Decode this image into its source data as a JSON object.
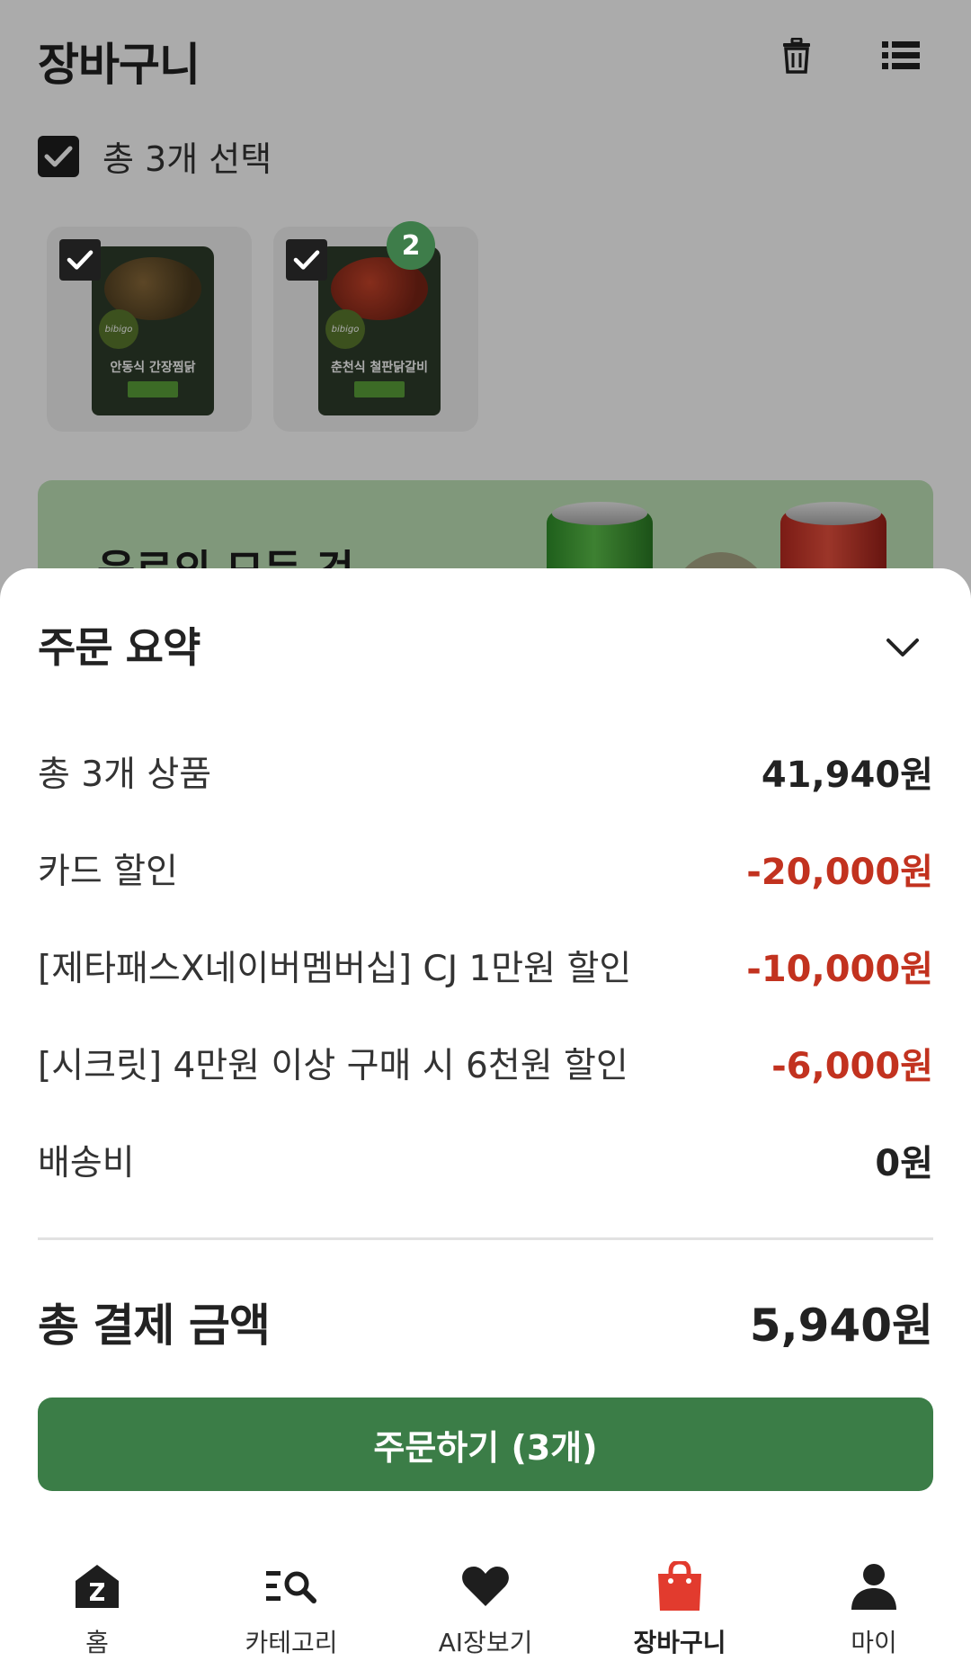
{
  "header": {
    "title": "장바구니",
    "trash_icon": "trash-icon",
    "list_icon": "list-view-icon"
  },
  "selection": {
    "label": "총 3개 선택",
    "checked": true
  },
  "cart_items": [
    {
      "name": "안동식 간장찜닭",
      "brand": "bibigo",
      "checked": true
    },
    {
      "name": "춘천식 철판닭갈비",
      "brand": "bibigo",
      "checked": true,
      "quantity_badge": "2"
    }
  ],
  "banner": {
    "text": "음료의 모든 것"
  },
  "order_summary": {
    "title": "주문 요약",
    "rows": [
      {
        "label": "총 3개 상품",
        "value": "41,940원",
        "type": "normal"
      },
      {
        "label": "카드 할인",
        "value": "-20,000원",
        "type": "discount"
      },
      {
        "label": "[제타패스X네이버멤버십] CJ 1만원 할인",
        "value": "-10,000원",
        "type": "discount"
      },
      {
        "label": "[시크릿] 4만원 이상 구매 시 6천원 할인",
        "value": "-6,000원",
        "type": "discount"
      },
      {
        "label": "배송비",
        "value": "0원",
        "type": "normal"
      }
    ],
    "total_label": "총 결제 금액",
    "total_value": "5,940원",
    "order_button_label": "주문하기 (3개)"
  },
  "nav": {
    "items": [
      {
        "label": "홈",
        "icon": "home-icon",
        "active": false
      },
      {
        "label": "카테고리",
        "icon": "category-search-icon",
        "active": false
      },
      {
        "label": "AI장보기",
        "icon": "heart-icon",
        "active": false
      },
      {
        "label": "장바구니",
        "icon": "shopping-bag-icon",
        "active": true
      },
      {
        "label": "마이",
        "icon": "person-icon",
        "active": false
      }
    ]
  },
  "colors": {
    "primary_green": "#3b7d47",
    "discount_red": "#c2321f",
    "active_nav_red": "#e23b2e"
  }
}
